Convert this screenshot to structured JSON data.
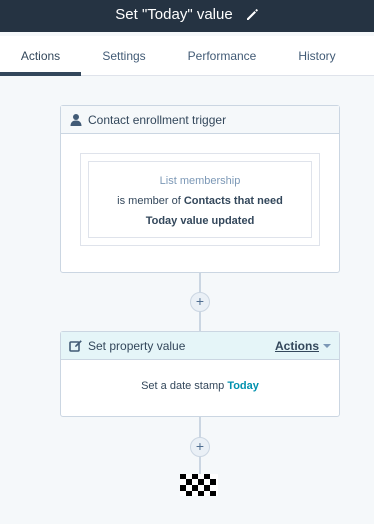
{
  "header": {
    "title": "Set \"Today\" value"
  },
  "tabs": [
    {
      "label": "Actions"
    },
    {
      "label": "Settings"
    },
    {
      "label": "Performance"
    },
    {
      "label": "History"
    }
  ],
  "trigger": {
    "header": "Contact enrollment trigger",
    "filter_title": "List membership",
    "filter_prefix": "is member of ",
    "filter_list_name": "Contacts that need Today value updated"
  },
  "action": {
    "header": "Set property value",
    "menu_label": "Actions",
    "text_prefix": "Set a date stamp ",
    "text_value": "Today"
  },
  "add_step_symbol": "+"
}
